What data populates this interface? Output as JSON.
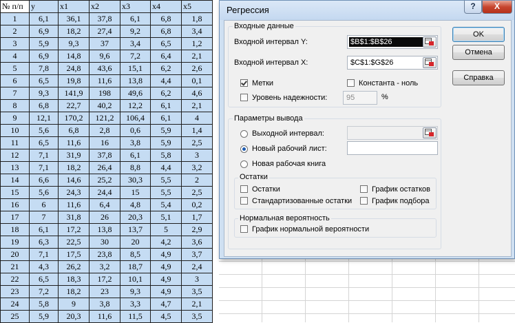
{
  "sheet": {
    "headers": [
      "№ п/п",
      "y",
      "x1",
      "x2",
      "x3",
      "x4",
      "x5"
    ],
    "rows": [
      [
        "1",
        "6,1",
        "36,1",
        "37,8",
        "6,1",
        "6,8",
        "1,8"
      ],
      [
        "2",
        "6,9",
        "18,2",
        "27,4",
        "9,2",
        "6,8",
        "3,4"
      ],
      [
        "3",
        "5,9",
        "9,3",
        "37",
        "3,4",
        "6,5",
        "1,2"
      ],
      [
        "4",
        "6,9",
        "14,8",
        "9,6",
        "7,2",
        "6,4",
        "2,1"
      ],
      [
        "5",
        "7,8",
        "24,8",
        "43,6",
        "15,1",
        "6,2",
        "2,6"
      ],
      [
        "6",
        "6,5",
        "19,8",
        "11,6",
        "13,8",
        "4,4",
        "0,1"
      ],
      [
        "7",
        "9,3",
        "141,9",
        "198",
        "49,6",
        "6,2",
        "4,6"
      ],
      [
        "8",
        "6,8",
        "22,7",
        "40,2",
        "12,2",
        "6,1",
        "2,1"
      ],
      [
        "9",
        "12,1",
        "170,2",
        "121,2",
        "106,4",
        "6,1",
        "4"
      ],
      [
        "10",
        "5,6",
        "6,8",
        "2,8",
        "0,6",
        "5,9",
        "1,4"
      ],
      [
        "11",
        "6,5",
        "11,6",
        "16",
        "3,8",
        "5,9",
        "2,5"
      ],
      [
        "12",
        "7,1",
        "31,9",
        "37,8",
        "6,1",
        "5,8",
        "3"
      ],
      [
        "13",
        "7,1",
        "18,2",
        "26,4",
        "8,8",
        "4,4",
        "3,2"
      ],
      [
        "14",
        "6,6",
        "14,6",
        "25,2",
        "30,3",
        "5,5",
        "2"
      ],
      [
        "15",
        "5,6",
        "24,3",
        "24,4",
        "15",
        "5,5",
        "2,5"
      ],
      [
        "16",
        "6",
        "11,6",
        "6,4",
        "4,8",
        "5,4",
        "0,2"
      ],
      [
        "17",
        "7",
        "31,8",
        "26",
        "20,3",
        "5,1",
        "1,7"
      ],
      [
        "18",
        "6,1",
        "17,2",
        "13,8",
        "13,7",
        "5",
        "2,9"
      ],
      [
        "19",
        "6,3",
        "22,5",
        "30",
        "20",
        "4,2",
        "3,6"
      ],
      [
        "20",
        "7,1",
        "17,5",
        "23,8",
        "8,5",
        "4,9",
        "3,7"
      ],
      [
        "21",
        "4,3",
        "26,2",
        "3,2",
        "18,7",
        "4,9",
        "2,4"
      ],
      [
        "22",
        "6,5",
        "18,3",
        "17,2",
        "10,1",
        "4,9",
        "3"
      ],
      [
        "23",
        "7,2",
        "18,2",
        "23",
        "9,3",
        "4,9",
        "3,5"
      ],
      [
        "24",
        "5,8",
        "9",
        "3,8",
        "3,3",
        "4,7",
        "2,1"
      ],
      [
        "25",
        "5,9",
        "20,3",
        "11,6",
        "11,5",
        "4,5",
        "3,5"
      ]
    ],
    "colors": {
      "selection_fill": "#c5dcf3",
      "border": "#1e1e1e"
    }
  },
  "dialog": {
    "title": "Регрессия",
    "help_glyph": "?",
    "close_glyph": "X",
    "input_group": {
      "title": "Входные данные",
      "y_label": "Входной интервал Y:",
      "y_value": "$B$1:$B$26",
      "x_label": "Входной интервал X:",
      "x_value": "$C$1:$G$26",
      "labels_checkbox": {
        "label": "Метки",
        "checked": true
      },
      "const_zero_checkbox": {
        "label": "Константа - ноль",
        "checked": false
      },
      "confidence_checkbox": {
        "label": "Уровень надежности:",
        "checked": false
      },
      "confidence_value": "95",
      "percent_sign": "%"
    },
    "output_group": {
      "title": "Параметры вывода",
      "output_range": {
        "label": "Выходной интервал:",
        "selected": false
      },
      "new_sheet": {
        "label": "Новый рабочий лист:",
        "selected": true
      },
      "new_workbook": {
        "label": "Новая рабочая книга",
        "selected": false
      }
    },
    "residuals_group": {
      "title": "Остатки",
      "residuals": {
        "label": "Остатки",
        "checked": false
      },
      "standardized": {
        "label": "Стандартизованные остатки",
        "checked": false
      },
      "residual_plot": {
        "label": "График остатков",
        "checked": false
      },
      "fit_plot": {
        "label": "График подбора",
        "checked": false
      }
    },
    "normal_group": {
      "title": "Нормальная вероятность",
      "normal_plot": {
        "label": "График нормальной вероятности",
        "checked": false
      }
    },
    "buttons": {
      "ok": "OK",
      "cancel": "Отмена",
      "help": "Справка"
    },
    "colors": {
      "frame": "#cfe0f2",
      "client": "#f0f0f0",
      "close_button": "#c7462e",
      "radio_dot": "#1d5bb0"
    }
  }
}
